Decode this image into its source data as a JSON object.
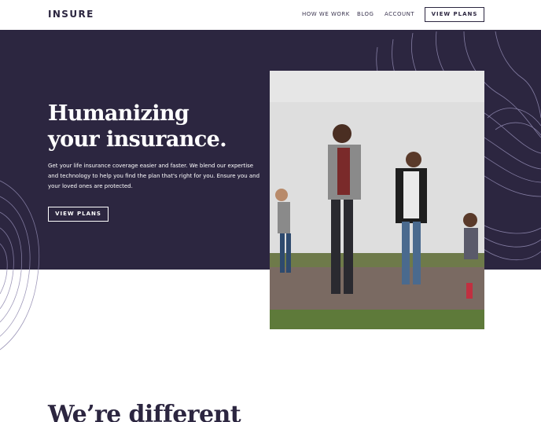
{
  "header": {
    "logo": "INSURE",
    "nav": [
      {
        "label": "HOW WE WORK"
      },
      {
        "label": "BLOG"
      },
      {
        "label": "ACCOUNT"
      }
    ],
    "cta_label": "VIEW PLANS"
  },
  "hero": {
    "title_line1": "Humanizing",
    "title_line2": "your insurance.",
    "description": "Get your life insurance coverage easier and faster. We blend our expertise and technology to help you find the plan that's right for you. Ensure you and your loved ones are protected.",
    "cta_label": "VIEW PLANS"
  },
  "section": {
    "title": "We’re different"
  },
  "colors": {
    "dark_violet": "#2c2640",
    "white": "#ffffff"
  }
}
